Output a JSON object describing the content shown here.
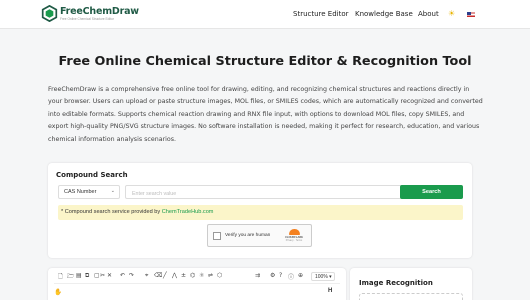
{
  "header": {
    "brand": "FreeChemDraw",
    "tagline": "Free Online Chemical Structure Editor",
    "nav": [
      "Structure Editor",
      "Knowledge Base",
      "About"
    ],
    "theme_icon": "sun-icon",
    "language_icon": "us-flag-icon"
  },
  "hero": {
    "title": "Free Online Chemical Structure Editor & Recognition Tool",
    "description": "FreeChemDraw is a comprehensive free online tool for drawing, editing, and recognizing chemical structures and reactions directly in your browser. Users can upload or paste structure images, MOL files, or SMILES codes, which are automatically recognized and converted into editable formats. Supports chemical reaction drawing and RNX file input, with options to download MOL files, copy SMILES, and export high-quality PNG/SVG structure images. No software installation is needed, making it perfect for research, education, and various chemical information analysis scenarios."
  },
  "compound_search": {
    "title": "Compound Search",
    "type_selected": "CAS Number",
    "placeholder": "Enter search value",
    "value": "",
    "button": "Search",
    "notice_prefix": "* Compound search service provided by ",
    "notice_link": "ChemTradeHub.com",
    "captcha_label": "Verify you are human",
    "captcha_brand": "CLOUDFLARE",
    "captcha_links": "Privacy · Terms"
  },
  "editor": {
    "zoom": "100%",
    "toolbar_icons": [
      "new-icon",
      "open-icon",
      "save-icon",
      "copy-icon",
      "paste-icon",
      "cut-icon",
      "delete-icon",
      "undo-icon",
      "redo-icon",
      "select-icon",
      "eraser-icon",
      "bond-icon",
      "chain-icon",
      "charge-icon",
      "ring-icon",
      "atom-icon",
      "reaction-icon",
      "template-icon",
      "settings-icon",
      "help-icon",
      "info-icon",
      "zoom-icon"
    ]
  },
  "image_recognition": {
    "title": "Image Recognition"
  },
  "colors": {
    "brand": "#1f5a45",
    "accent": "#1a9b4d",
    "notice_bg": "#fbf5c9"
  }
}
